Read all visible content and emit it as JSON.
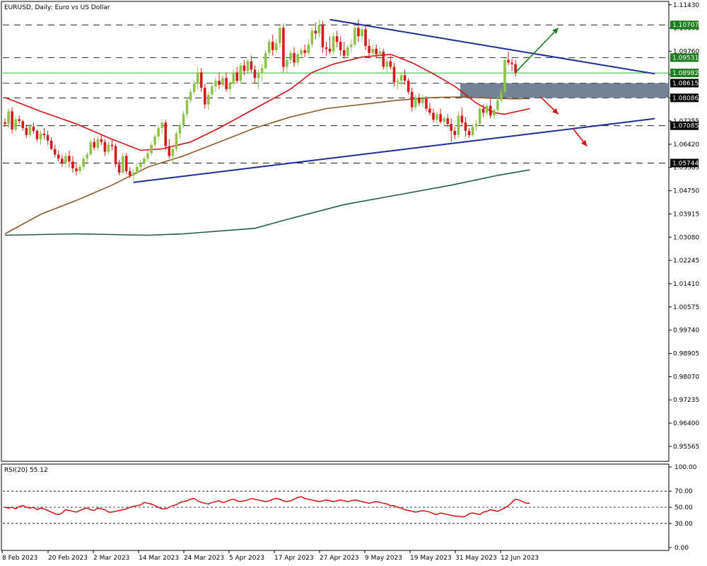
{
  "chart_data": {
    "type": "candlestick",
    "title": "EURUSD, Daily:  Euro vs US Dollar",
    "x_tick_labels": [
      "8 Feb 2023",
      "20 Feb 2023",
      "2 Mar 2023",
      "14 Mar 2023",
      "24 Mar 2023",
      "5 Apr 2023",
      "17 Apr 2023",
      "27 Apr 2023",
      "9 May 2023",
      "19 May 2023",
      "31 May 2023",
      "12 Jun 2023"
    ],
    "ylim": [
      0.9508,
      1.115
    ],
    "y_tick_labels": [
      "1.11430",
      "1.10595",
      "1.09760",
      "1.08925",
      "1.08090",
      "1.07255",
      "1.06420",
      "1.05585",
      "1.04750",
      "1.03915",
      "1.03080",
      "1.02245",
      "1.01410",
      "1.00575",
      "0.99740",
      "0.98905",
      "0.98070",
      "0.97235",
      "0.96400",
      "0.95565"
    ],
    "levels": [
      {
        "value": 1.10707,
        "label": "1.10707",
        "color": "#1a7f1a"
      },
      {
        "value": 1.09531,
        "label": "1.09531",
        "color": "#1a7f1a"
      },
      {
        "value": 1.08982,
        "label": "1.08982",
        "color": "#1a7f1a"
      },
      {
        "value": 1.08615,
        "label": "1.08615",
        "color": "#000000"
      },
      {
        "value": 1.08086,
        "label": "1.08086",
        "color": "#000000"
      },
      {
        "value": 1.07085,
        "label": "1.07085",
        "color": "#000000"
      },
      {
        "value": 1.05744,
        "label": "1.05744",
        "color": "#000000"
      }
    ],
    "zone": {
      "low": 1.08086,
      "high": 1.08615
    },
    "trendlines": [
      {
        "from": [
          91,
          1.109
        ],
        "to": [
          182,
          1.0895
        ]
      },
      {
        "from": [
          36,
          1.0505
        ],
        "to": [
          182,
          1.0734
        ]
      }
    ],
    "arrows": [
      {
        "from": [
          143,
          1.09
        ],
        "to": [
          155,
          1.106
        ],
        "color": "#1a7f1a"
      },
      {
        "from": [
          150,
          1.0812
        ],
        "to": [
          155,
          1.075
        ],
        "color": "#d01010"
      },
      {
        "from": [
          159,
          1.07
        ],
        "to": [
          163,
          1.0635
        ],
        "color": "#d01010"
      }
    ],
    "ma_series": [
      {
        "color": "#d01010",
        "points": [
          [
            0,
            1.081
          ],
          [
            10,
            1.076
          ],
          [
            20,
            1.0715
          ],
          [
            30,
            1.066
          ],
          [
            38,
            1.062
          ],
          [
            44,
            1.0625
          ],
          [
            52,
            1.065
          ],
          [
            60,
            1.07
          ],
          [
            70,
            1.077
          ],
          [
            80,
            1.084
          ],
          [
            86,
            1.09
          ],
          [
            92,
            1.093
          ],
          [
            100,
            1.0955
          ],
          [
            108,
            1.0965
          ],
          [
            114,
            1.0935
          ],
          [
            120,
            1.0895
          ],
          [
            126,
            1.085
          ],
          [
            132,
            1.079
          ],
          [
            137,
            1.0755
          ],
          [
            140,
            1.075
          ],
          [
            147,
            1.077
          ]
        ]
      },
      {
        "color": "#8b5a2b",
        "points": [
          [
            0,
            1.032
          ],
          [
            10,
            1.039
          ],
          [
            20,
            1.044
          ],
          [
            30,
            1.0495
          ],
          [
            40,
            1.056
          ],
          [
            50,
            1.06
          ],
          [
            60,
            1.065
          ],
          [
            70,
            1.07
          ],
          [
            80,
            1.074
          ],
          [
            90,
            1.077
          ],
          [
            100,
            1.0785
          ],
          [
            110,
            1.08
          ],
          [
            120,
            1.081
          ],
          [
            128,
            1.0812
          ],
          [
            135,
            1.0808
          ],
          [
            142,
            1.0805
          ],
          [
            147,
            1.0806
          ]
        ]
      },
      {
        "color": "#1f5e4a",
        "points": [
          [
            0,
            1.0315
          ],
          [
            20,
            1.032
          ],
          [
            40,
            1.0315
          ],
          [
            50,
            1.032
          ],
          [
            70,
            1.034
          ],
          [
            80,
            1.0375
          ],
          [
            95,
            1.0425
          ],
          [
            110,
            1.046
          ],
          [
            125,
            1.0495
          ],
          [
            138,
            1.053
          ],
          [
            147,
            1.055
          ]
        ]
      }
    ],
    "candles": [
      [
        1.0721,
        1.0735,
        1.0705,
        1.0715
      ],
      [
        1.0715,
        1.077,
        1.07,
        1.076
      ],
      [
        1.076,
        1.0775,
        1.068,
        1.0695
      ],
      [
        1.0695,
        1.0742,
        1.0688,
        1.0732
      ],
      [
        1.0732,
        1.0745,
        1.0715,
        1.0725
      ],
      [
        1.0725,
        1.073,
        1.069,
        1.07
      ],
      [
        1.07,
        1.0712,
        1.0665,
        1.0675
      ],
      [
        1.0675,
        1.0715,
        1.0668,
        1.0705
      ],
      [
        1.0705,
        1.072,
        1.068,
        1.069
      ],
      [
        1.069,
        1.0695,
        1.065,
        1.066
      ],
      [
        1.066,
        1.069,
        1.064,
        1.068
      ],
      [
        1.068,
        1.07,
        1.066,
        1.0675
      ],
      [
        1.0675,
        1.069,
        1.064,
        1.0655
      ],
      [
        1.0655,
        1.0668,
        1.062,
        1.0625
      ],
      [
        1.0625,
        1.064,
        1.0595,
        1.0605
      ],
      [
        1.0605,
        1.062,
        1.058,
        1.059
      ],
      [
        1.059,
        1.0605,
        1.056,
        1.0575
      ],
      [
        1.0575,
        1.0612,
        1.056,
        1.06
      ],
      [
        1.06,
        1.062,
        1.056,
        1.058
      ],
      [
        1.058,
        1.06,
        1.054,
        1.0555
      ],
      [
        1.0555,
        1.057,
        1.053,
        1.0545
      ],
      [
        1.0545,
        1.057,
        1.0535,
        1.056
      ],
      [
        1.056,
        1.06,
        1.055,
        1.059
      ],
      [
        1.059,
        1.0615,
        1.0575,
        1.0605
      ],
      [
        1.0605,
        1.066,
        1.06,
        1.065
      ],
      [
        1.065,
        1.0665,
        1.062,
        1.063
      ],
      [
        1.063,
        1.067,
        1.062,
        1.066
      ],
      [
        1.066,
        1.0675,
        1.064,
        1.065
      ],
      [
        1.065,
        1.066,
        1.06,
        1.0615
      ],
      [
        1.0615,
        1.065,
        1.0605,
        1.064
      ],
      [
        1.064,
        1.066,
        1.062,
        1.0635
      ],
      [
        1.0635,
        1.0645,
        1.056,
        1.057
      ],
      [
        1.057,
        1.0585,
        1.053,
        1.054
      ],
      [
        1.054,
        1.061,
        1.0535,
        1.06
      ],
      [
        1.06,
        1.061,
        1.0535,
        1.0545
      ],
      [
        1.0545,
        1.056,
        1.052,
        1.053
      ],
      [
        1.053,
        1.0555,
        1.051,
        1.054
      ],
      [
        1.054,
        1.0575,
        1.0535,
        1.056
      ],
      [
        1.056,
        1.0585,
        1.055,
        1.0575
      ],
      [
        1.0575,
        1.06,
        1.056,
        1.059
      ],
      [
        1.059,
        1.062,
        1.058,
        1.061
      ],
      [
        1.061,
        1.065,
        1.06,
        1.064
      ],
      [
        1.064,
        1.068,
        1.063,
        1.067
      ],
      [
        1.067,
        1.071,
        1.0655,
        1.07
      ],
      [
        1.07,
        1.073,
        1.068,
        1.072
      ],
      [
        1.072,
        1.073,
        1.062,
        1.0635
      ],
      [
        1.0635,
        1.066,
        1.059,
        1.06
      ],
      [
        1.06,
        1.0635,
        1.0575,
        1.0625
      ],
      [
        1.0625,
        1.069,
        1.0615,
        1.068
      ],
      [
        1.068,
        1.072,
        1.066,
        1.071
      ],
      [
        1.071,
        1.076,
        1.07,
        1.075
      ],
      [
        1.075,
        1.081,
        1.074,
        1.08
      ],
      [
        1.08,
        1.084,
        1.079,
        1.083
      ],
      [
        1.083,
        1.087,
        1.082,
        1.086
      ],
      [
        1.086,
        1.092,
        1.084,
        1.09
      ],
      [
        1.09,
        1.0915,
        1.083,
        1.0845
      ],
      [
        1.0845,
        1.086,
        1.077,
        1.0785
      ],
      [
        1.0785,
        1.083,
        1.0765,
        1.082
      ],
      [
        1.082,
        1.086,
        1.081,
        1.085
      ],
      [
        1.085,
        1.088,
        1.083,
        1.087
      ],
      [
        1.087,
        1.09,
        1.084,
        1.0855
      ],
      [
        1.0855,
        1.089,
        1.0845,
        1.088
      ],
      [
        1.088,
        1.09,
        1.083,
        1.084
      ],
      [
        1.084,
        1.087,
        1.082,
        1.086
      ],
      [
        1.086,
        1.091,
        1.085,
        1.09
      ],
      [
        1.09,
        1.092,
        1.086,
        1.087
      ],
      [
        1.087,
        1.0935,
        1.086,
        1.0925
      ],
      [
        1.0925,
        1.0945,
        1.089,
        1.0905
      ],
      [
        1.0905,
        1.095,
        1.0895,
        1.094
      ],
      [
        1.094,
        1.096,
        1.09,
        1.091
      ],
      [
        1.091,
        1.0925,
        1.086,
        1.088
      ],
      [
        1.088,
        1.091,
        1.084,
        1.09
      ],
      [
        1.09,
        1.093,
        1.087,
        1.0915
      ],
      [
        1.0915,
        1.098,
        1.091,
        1.097
      ],
      [
        1.097,
        1.102,
        1.096,
        1.101
      ],
      [
        1.101,
        1.1035,
        1.096,
        1.098
      ],
      [
        1.098,
        1.102,
        1.097,
        1.1005
      ],
      [
        1.1005,
        1.107,
        1.099,
        1.106
      ],
      [
        1.106,
        1.1075,
        1.09,
        1.092
      ],
      [
        1.092,
        1.096,
        1.09,
        1.0945
      ],
      [
        1.0945,
        1.098,
        1.093,
        1.097
      ],
      [
        1.097,
        1.099,
        1.092,
        1.0935
      ],
      [
        1.0935,
        1.0975,
        1.0925,
        1.0965
      ],
      [
        1.0965,
        1.099,
        1.095,
        1.098
      ],
      [
        1.098,
        1.1,
        1.0955,
        1.097
      ],
      [
        1.097,
        1.102,
        1.096,
        1.1
      ],
      [
        1.1,
        1.106,
        1.099,
        1.105
      ],
      [
        1.105,
        1.108,
        1.102,
        1.104
      ],
      [
        1.104,
        1.109,
        1.1025,
        1.107
      ],
      [
        1.107,
        1.1085,
        1.097,
        1.099
      ],
      [
        1.099,
        1.101,
        1.096,
        1.0985
      ],
      [
        1.0985,
        1.103,
        1.0965,
        1.0975
      ],
      [
        1.0975,
        1.1045,
        1.0965,
        1.103
      ],
      [
        1.103,
        1.105,
        1.099,
        1.101
      ],
      [
        1.101,
        1.103,
        1.096,
        1.098
      ],
      [
        1.098,
        1.101,
        1.095,
        1.096
      ],
      [
        1.096,
        1.1,
        1.095,
        1.099
      ],
      [
        1.099,
        1.102,
        1.097,
        1.1
      ],
      [
        1.1,
        1.108,
        1.099,
        1.106
      ],
      [
        1.106,
        1.109,
        1.101,
        1.103
      ],
      [
        1.103,
        1.1065,
        1.101,
        1.1055
      ],
      [
        1.1055,
        1.107,
        1.098,
        1.0995
      ],
      [
        1.0995,
        1.102,
        1.095,
        1.097
      ],
      [
        1.097,
        1.1,
        1.0955,
        1.0985
      ],
      [
        1.0985,
        1.1,
        1.095,
        1.0965
      ],
      [
        1.0965,
        1.099,
        1.094,
        1.0975
      ],
      [
        1.0975,
        1.0985,
        1.091,
        1.092
      ],
      [
        1.092,
        1.095,
        1.09,
        1.094
      ],
      [
        1.094,
        1.096,
        1.091,
        1.092
      ],
      [
        1.092,
        1.0935,
        1.085,
        1.0865
      ],
      [
        1.0865,
        1.088,
        1.084,
        1.087
      ],
      [
        1.087,
        1.09,
        1.085,
        1.089
      ],
      [
        1.089,
        1.091,
        1.0855,
        1.087
      ],
      [
        1.087,
        1.088,
        1.082,
        1.083
      ],
      [
        1.083,
        1.0845,
        1.076,
        1.0775
      ],
      [
        1.0775,
        1.082,
        1.0765,
        1.081
      ],
      [
        1.081,
        1.0825,
        1.078,
        1.079
      ],
      [
        1.079,
        1.082,
        1.0775,
        1.0805
      ],
      [
        1.0805,
        1.0815,
        1.076,
        1.077
      ],
      [
        1.077,
        1.079,
        1.0745,
        1.0755
      ],
      [
        1.0755,
        1.077,
        1.072,
        1.073
      ],
      [
        1.073,
        1.076,
        1.0715,
        1.075
      ],
      [
        1.075,
        1.077,
        1.0715,
        1.0722
      ],
      [
        1.0722,
        1.0745,
        1.071,
        1.0735
      ],
      [
        1.0735,
        1.075,
        1.0705,
        1.0715
      ],
      [
        1.0715,
        1.0735,
        1.065,
        1.069
      ],
      [
        1.069,
        1.0705,
        1.066,
        1.0675
      ],
      [
        1.0675,
        1.076,
        1.0665,
        1.0745
      ],
      [
        1.0745,
        1.0775,
        1.0705,
        1.072
      ],
      [
        1.072,
        1.074,
        1.067,
        1.069
      ],
      [
        1.069,
        1.07,
        1.0665,
        1.0675
      ],
      [
        1.0675,
        1.0715,
        1.0668,
        1.0705
      ],
      [
        1.0705,
        1.073,
        1.069,
        1.0715
      ],
      [
        1.0715,
        1.078,
        1.071,
        1.077
      ],
      [
        1.077,
        1.0785,
        1.074,
        1.0755
      ],
      [
        1.0755,
        1.079,
        1.0745,
        1.078
      ],
      [
        1.078,
        1.081,
        1.0735,
        1.0745
      ],
      [
        1.0745,
        1.077,
        1.0735,
        1.0765
      ],
      [
        1.0765,
        1.0815,
        1.0755,
        1.08
      ],
      [
        1.08,
        1.084,
        1.079,
        1.083
      ],
      [
        1.083,
        1.095,
        1.082,
        1.0945
      ],
      [
        1.0945,
        1.0975,
        1.0925,
        1.0935
      ],
      [
        1.0935,
        1.095,
        1.0905,
        1.093
      ],
      [
        1.093,
        1.0945,
        1.0885,
        1.0898
      ]
    ],
    "rsi": {
      "label": "RSI(20) 55.12",
      "ylim": [
        0,
        100
      ],
      "tick_labels": [
        "100.00",
        "70.00",
        "50.00",
        "30.00",
        "0.00"
      ],
      "tick_values": [
        100,
        70,
        50,
        30,
        0
      ],
      "levels": [
        70,
        50,
        30
      ],
      "color": "#d01010",
      "values": [
        50,
        49,
        50,
        48,
        51,
        52,
        50,
        49,
        50,
        47,
        49,
        48,
        46,
        44,
        42,
        41,
        43,
        47,
        46,
        45,
        44,
        46,
        48,
        49,
        47,
        46,
        49,
        48,
        47,
        44,
        44,
        45,
        46,
        47,
        48,
        50,
        51,
        52,
        53,
        56,
        55,
        54,
        52,
        50,
        48,
        48,
        50,
        52,
        53,
        56,
        57,
        58,
        60,
        61,
        58,
        56,
        55,
        54,
        56,
        57,
        58,
        56,
        57,
        59,
        60,
        58,
        57,
        58,
        59,
        61,
        60,
        59,
        58,
        57,
        58,
        60,
        61,
        60,
        58,
        57,
        58,
        60,
        62,
        63,
        61,
        60,
        59,
        58,
        57,
        58,
        59,
        58,
        57,
        58,
        59,
        58,
        57,
        58,
        59,
        58,
        57,
        56,
        55,
        56,
        57,
        56,
        55,
        54,
        52,
        52,
        50,
        49,
        47,
        46,
        45,
        44,
        45,
        46,
        45,
        44,
        42,
        41,
        43,
        42,
        41,
        40,
        39,
        39,
        38,
        39,
        42,
        43,
        42,
        41,
        44,
        45,
        47,
        46,
        45,
        47,
        49,
        52,
        56,
        60,
        59,
        57,
        55,
        55
      ]
    }
  }
}
